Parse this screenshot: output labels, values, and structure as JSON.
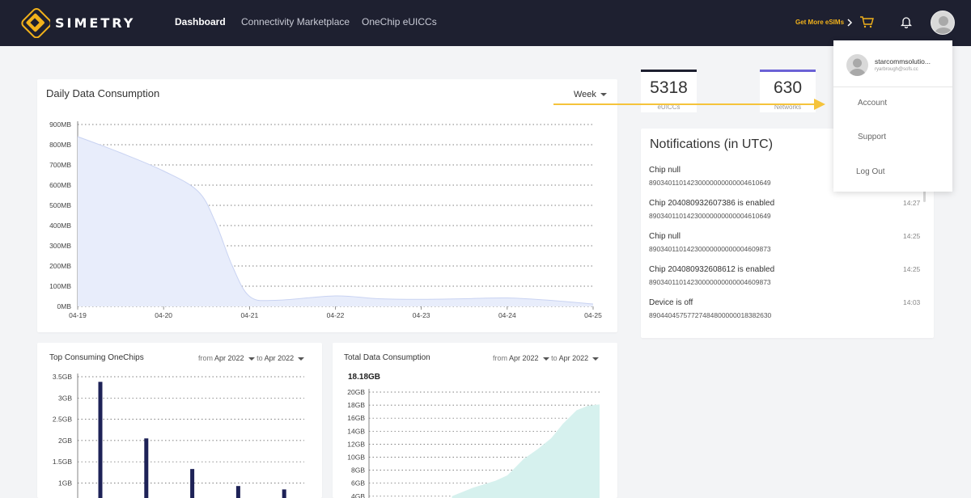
{
  "brand": {
    "name": "SIMETRY",
    "accent": "#f2b21b",
    "nav_bg": "#1e2030"
  },
  "nav": {
    "items": [
      "Dashboard",
      "Connectivity Marketplace",
      "OneChip eUICCs"
    ],
    "active": "Dashboard",
    "get_more": "Get More eSIMs",
    "icons": [
      "chevron-right-icon",
      "cart-icon",
      "bell-icon",
      "avatar-icon"
    ]
  },
  "daily": {
    "title": "Daily Data Consumption",
    "period": "Week",
    "chart_data": {
      "type": "area",
      "x": [
        "04-19",
        "04-20",
        "04-21",
        "04-22",
        "04-23",
        "04-24",
        "04-25"
      ],
      "ylabels": [
        "900MB",
        "800MB",
        "700MB",
        "600MB",
        "500MB",
        "400MB",
        "300MB",
        "200MB",
        "100MB",
        "0MB"
      ],
      "ylim": [
        0,
        900
      ],
      "points": [
        [
          0,
          840
        ],
        [
          0.5,
          760
        ],
        [
          1,
          670
        ],
        [
          1.4,
          570
        ],
        [
          1.6,
          420
        ],
        [
          1.8,
          200
        ],
        [
          2.0,
          50
        ],
        [
          2.3,
          30
        ],
        [
          3.0,
          52
        ],
        [
          3.5,
          38
        ],
        [
          4.0,
          35
        ],
        [
          4.5,
          38
        ],
        [
          5.0,
          42
        ],
        [
          5.5,
          30
        ],
        [
          6.0,
          12
        ]
      ],
      "fill": "#e8edfb",
      "stroke": "#c9d3f2",
      "grid": true
    }
  },
  "stats": [
    {
      "value": "5318",
      "label": "eUICCs",
      "color": "#1e2030"
    },
    {
      "value": "630",
      "label": "Networks",
      "color": "#6b62d6"
    }
  ],
  "notifications": {
    "title": "Notifications (in UTC)",
    "items": [
      {
        "title": "Chip null",
        "sub": "89034011014230000000000004610649",
        "time": ""
      },
      {
        "title": "Chip 204080932607386 is enabled",
        "sub": "89034011014230000000000004610649",
        "time": "14:27"
      },
      {
        "title": "Chip null",
        "sub": "89034011014230000000000004609873",
        "time": "14:25"
      },
      {
        "title": "Chip 204080932608612 is enabled",
        "sub": "89034011014230000000000004609873",
        "time": "14:25"
      },
      {
        "title": "Device is off",
        "sub": "89044045757727484800000018382630",
        "time": "14:03"
      }
    ]
  },
  "top_chips": {
    "title": "Top Consuming OneChips",
    "from_label": "from",
    "from": "Apr 2022",
    "to_label": "to",
    "to": "Apr 2022",
    "chart_data": {
      "type": "bar",
      "ylabels": [
        "3.5GB",
        "3GB",
        "2.5GB",
        "2GB",
        "1.5GB",
        "1GB"
      ],
      "ylim": [
        0,
        3.5
      ],
      "values": [
        3.38,
        2.05,
        1.33,
        0.93,
        0.85
      ],
      "bar_color": "#1e2257",
      "grid": true
    }
  },
  "total": {
    "title": "Total Data Consumption",
    "from_label": "from",
    "from": "Apr 2022",
    "to_label": "to",
    "to": "Apr 2022",
    "total_value": "18.18GB",
    "chart_data": {
      "type": "area",
      "ylabels": [
        "20GB",
        "18GB",
        "16GB",
        "14GB",
        "12GB",
        "10GB",
        "8GB",
        "6GB",
        "4GB"
      ],
      "ylim": [
        4,
        20
      ],
      "points": [
        [
          0.36,
          4
        ],
        [
          0.45,
          5.3
        ],
        [
          0.55,
          6.4
        ],
        [
          0.6,
          7.2
        ],
        [
          0.67,
          9.7
        ],
        [
          0.73,
          11.2
        ],
        [
          0.79,
          12.9
        ],
        [
          0.84,
          15.1
        ],
        [
          0.9,
          17.2
        ],
        [
          0.95,
          17.9
        ],
        [
          1.0,
          18.1
        ]
      ],
      "fill": "#d6f1ee",
      "grid": true
    }
  },
  "user_menu": {
    "name": "starcommsolutio...",
    "email": "ryarbrough@sofs.cc",
    "items": [
      "Account",
      "Support",
      "Log Out"
    ]
  },
  "annotation": {
    "color": "#f5c33b"
  }
}
